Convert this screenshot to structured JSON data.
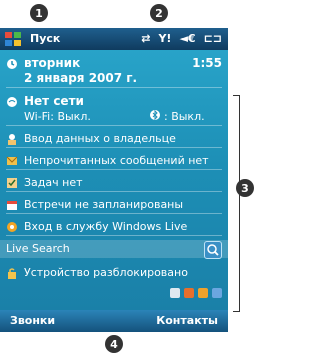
{
  "callouts": {
    "c1": "1",
    "c2": "2",
    "c3": "3",
    "c4": "4"
  },
  "topbar": {
    "title": "Пуск"
  },
  "status": {
    "clock": "1:55"
  },
  "today": {
    "day": "вторник",
    "date": "2 января 2007 г.",
    "network_title": "Нет сети",
    "wifi": "Wi-Fi: Выкл.",
    "bluetooth": ": Выкл.",
    "owner": "Ввод данных о владельце",
    "messages": "Непрочитанных сообщений нет",
    "tasks": "Задач нет",
    "meetings": "Встречи не запланированы",
    "windows_live": "Вход в службу Windows Live",
    "lock": "Устройство разблокировано"
  },
  "search": {
    "label": "Live Search"
  },
  "softkeys": {
    "left": "Звонки",
    "right": "Контакты"
  },
  "colors": {
    "accent": "#1d8fb6",
    "topbar": "#0f3b5f",
    "callout": "#333333"
  }
}
